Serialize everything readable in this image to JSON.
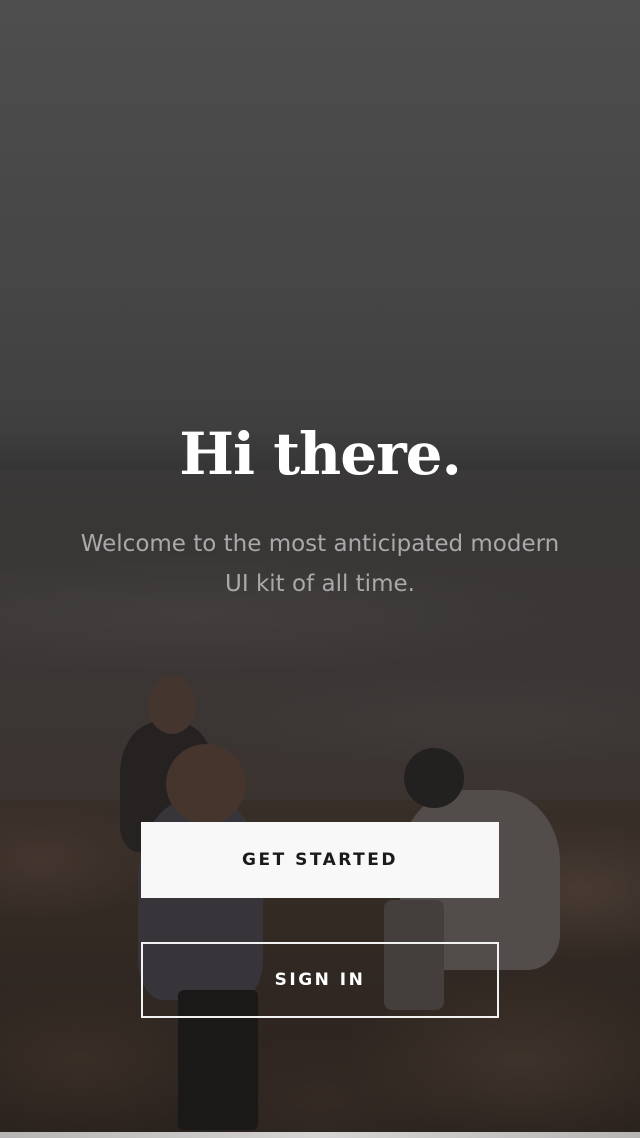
{
  "welcome": {
    "title": "Hi there.",
    "subtitle": "Welcome to the most anticipated modern UI kit of all time."
  },
  "actions": {
    "primary_label": "GET STARTED",
    "secondary_label": "SIGN IN"
  },
  "colors": {
    "title": "#ffffff",
    "subtitle": "#a9a9a9",
    "primary_button_bg": "#f8f8f8",
    "primary_button_text": "#1a1a1a",
    "secondary_button_border": "#f2f2f2",
    "secondary_button_text": "#ffffff"
  }
}
